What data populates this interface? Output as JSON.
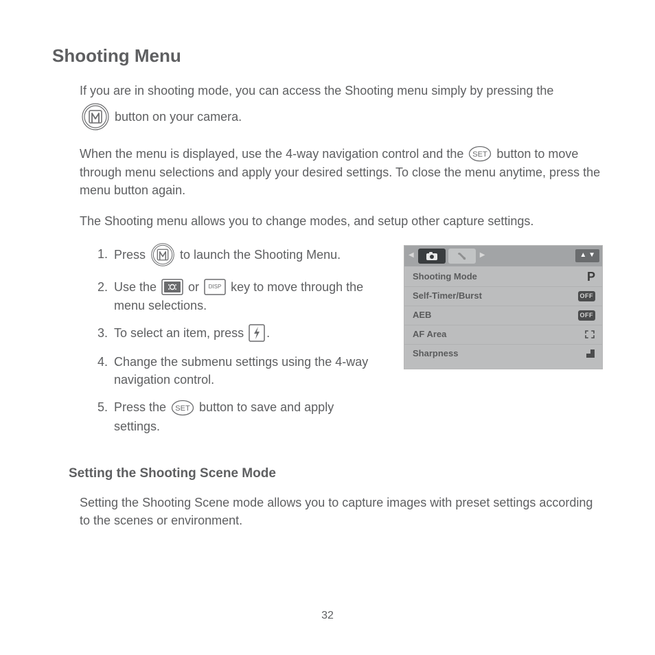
{
  "heading": "Shooting Menu",
  "intro1a": "If you are in shooting mode, you can access the Shooting menu simply by pressing the ",
  "intro1b": " button on your camera.",
  "intro2a": "When the menu is displayed, use the 4-way navigation control and the ",
  "intro2b": " button to move through menu selections and apply your desired settings. To close the menu anytime, press the menu button again.",
  "intro3": "The Shooting menu allows you to change modes, and setup other capture settings.",
  "steps": {
    "s1a": "Press ",
    "s1b": " to launch the Shooting Menu.",
    "s2a": "Use the ",
    "s2or": " or ",
    "s2b": " key to move through the menu selections.",
    "s3a": "To select an item, press ",
    "s3b": ".",
    "s4": "Change the submenu settings using the 4-way navigation control.",
    "s5a": "Press the ",
    "s5b": " button to save and apply settings."
  },
  "subheading": "Setting the Shooting Scene Mode",
  "subpara": "Setting the Shooting Scene mode allows you to capture images with preset settings according to the scenes or environment.",
  "lcd": {
    "rows": [
      {
        "label": "Shooting Mode",
        "value": "P",
        "kind": "p"
      },
      {
        "label": "Self-Timer/Burst",
        "value": "OFF",
        "kind": "off"
      },
      {
        "label": "AEB",
        "value": "OFF",
        "kind": "off"
      },
      {
        "label": "AF Area",
        "value": "",
        "kind": "af"
      },
      {
        "label": "Sharpness",
        "value": "",
        "kind": "sharp"
      }
    ],
    "arrows": "▲ ▼"
  },
  "disp_label": "DISP",
  "set_label": "SET",
  "page_number": "32"
}
